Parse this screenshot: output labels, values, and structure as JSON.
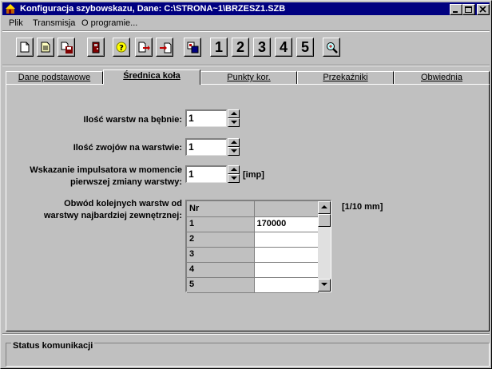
{
  "window": {
    "title": "Konfiguracja szybowskazu, Dane: C:\\STRONA~1\\BRZESZ1.SZB"
  },
  "menu": [
    {
      "label": "Plik"
    },
    {
      "label": "Transmisja"
    },
    {
      "label": "O programie..."
    }
  ],
  "toolbar": {
    "icons": [
      "new-file-icon",
      "open-file-icon",
      "save-disk-icon",
      "exit-door-icon",
      "help-icon",
      "export-arrow-icon",
      "import-arrow-icon",
      "palette-icon",
      "zoom-icon"
    ],
    "numbers": [
      "1",
      "2",
      "3",
      "4",
      "5"
    ]
  },
  "tabs": [
    {
      "label": "Dane podstawowe",
      "active": false
    },
    {
      "label": "Średnica koła",
      "active": true
    },
    {
      "label": "Punkty kor.",
      "active": false
    },
    {
      "label": "Przekaźniki",
      "active": false
    },
    {
      "label": "Obwiednia",
      "active": false
    }
  ],
  "form": {
    "layers_label": "Ilość warstw na bębnie:",
    "layers_value": "1",
    "turns_label": "Ilość zwojów na warstwie:",
    "turns_value": "1",
    "impulse_label_1": "Wskazanie impulsatora w momencie",
    "impulse_label_2": "pierwszej zmiany warstwy:",
    "impulse_value": "1",
    "impulse_unit": "[imp]",
    "circ_label_1": "Obwód kolejnych warstw od",
    "circ_label_2": "warstwy najbardziej zewnętrznej:",
    "circ_unit": "[1/10 mm]"
  },
  "grid": {
    "header": [
      "Nr",
      ""
    ],
    "rows": [
      {
        "nr": "1",
        "value": "170000"
      },
      {
        "nr": "2",
        "value": ""
      },
      {
        "nr": "3",
        "value": ""
      },
      {
        "nr": "4",
        "value": ""
      },
      {
        "nr": "5",
        "value": ""
      }
    ]
  },
  "status": {
    "title": "Status komunikacji"
  },
  "colors": {
    "titlebar": "#000080",
    "face": "#c0c0c0"
  }
}
